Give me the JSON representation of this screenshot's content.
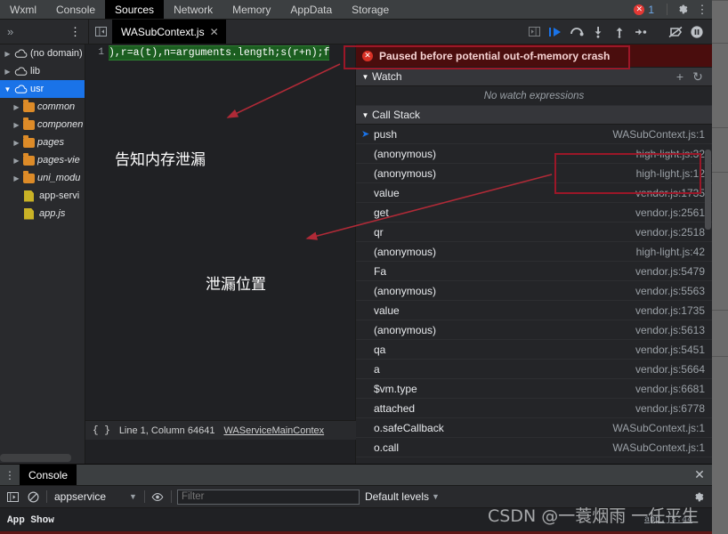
{
  "window": {
    "tabs": [
      {
        "label": "Wxml",
        "active": false
      },
      {
        "label": "Console",
        "active": false
      },
      {
        "label": "Sources",
        "active": true
      },
      {
        "label": "Network",
        "active": false
      },
      {
        "label": "Memory",
        "active": false
      },
      {
        "label": "AppData",
        "active": false
      },
      {
        "label": "Storage",
        "active": false
      }
    ],
    "error_count": "1",
    "error_icon": "error-circle-icon",
    "settings_icon": "gear-icon",
    "more_icon": "kebab-menu-icon"
  },
  "toolbar": {
    "more_tabs_icon": "chevron-double-right-icon",
    "panel_menu_icon": "kebab-menu-icon",
    "show_navigator_icon": "show-navigator-icon",
    "show_debugger_icon": "show-debugger-icon",
    "file_tab": {
      "label": "WASubContext.js",
      "close_icon": "close-icon"
    },
    "debug_buttons": [
      {
        "name": "resume-button",
        "glyph": "resume-icon"
      },
      {
        "name": "step-over-button",
        "glyph": "step-over-icon"
      },
      {
        "name": "step-into-button",
        "glyph": "step-into-icon"
      },
      {
        "name": "step-out-button",
        "glyph": "step-out-icon"
      },
      {
        "name": "step-button",
        "glyph": "step-icon"
      },
      {
        "name": "deactivate-breakpoints-button",
        "glyph": "deactivate-breakpoints-icon"
      },
      {
        "name": "pause-on-exceptions-button",
        "glyph": "pause-icon"
      }
    ]
  },
  "navigator": {
    "items": [
      {
        "label": "(no domain)",
        "icon": "cloud-icon",
        "expanded": false,
        "indent": 0,
        "selected": false,
        "type": "domain"
      },
      {
        "label": "lib",
        "icon": "cloud-icon",
        "expanded": false,
        "indent": 0,
        "selected": false,
        "type": "domain"
      },
      {
        "label": "usr",
        "icon": "cloud-icon",
        "expanded": true,
        "indent": 0,
        "selected": true,
        "type": "domain"
      },
      {
        "label": "common",
        "icon": "folder-icon",
        "expanded": false,
        "indent": 1,
        "selected": false,
        "type": "folder"
      },
      {
        "label": "componen",
        "icon": "folder-icon",
        "expanded": false,
        "indent": 1,
        "selected": false,
        "type": "folder"
      },
      {
        "label": "pages",
        "icon": "folder-icon",
        "expanded": false,
        "indent": 1,
        "selected": false,
        "type": "folder"
      },
      {
        "label": "pages-vie",
        "icon": "folder-icon",
        "expanded": false,
        "indent": 1,
        "selected": false,
        "type": "folder"
      },
      {
        "label": "uni_modu",
        "icon": "folder-icon",
        "expanded": false,
        "indent": 1,
        "selected": false,
        "type": "folder"
      },
      {
        "label": "app-servi",
        "icon": "file-icon",
        "expanded": null,
        "indent": 1,
        "selected": false,
        "type": "file"
      },
      {
        "label": "app.js",
        "icon": "file-icon",
        "expanded": null,
        "indent": 1,
        "selected": false,
        "type": "file"
      }
    ]
  },
  "editor": {
    "line_number": "1",
    "code": "),r=a(t),n=arguments.length;s(r+n);f",
    "annotations": [
      {
        "text": "告知内存泄漏",
        "name": "annotation-memory-leak-notice"
      },
      {
        "text": "泄漏位置",
        "name": "annotation-leak-location"
      }
    ]
  },
  "status_bar": {
    "braces_icon": "format-braces-icon",
    "position": "Line 1, Column 64641",
    "context_link": "WAServiceMainContex"
  },
  "debugger": {
    "paused_banner": {
      "text": "Paused before potential out-of-memory crash",
      "icon": "error-circle-icon"
    },
    "watch": {
      "title": "Watch",
      "empty_text": "No watch expressions",
      "add_icon": "plus-icon",
      "refresh_icon": "refresh-icon"
    },
    "call_stack": {
      "title": "Call Stack",
      "frames": [
        {
          "fn": "push",
          "loc": "WASubContext.js:1",
          "current": true
        },
        {
          "fn": "(anonymous)",
          "loc": "high-light.js:32",
          "current": false
        },
        {
          "fn": "(anonymous)",
          "loc": "high-light.js:12",
          "current": false
        },
        {
          "fn": "value",
          "loc": "vendor.js:1735",
          "current": false
        },
        {
          "fn": "get",
          "loc": "vendor.js:2561",
          "current": false
        },
        {
          "fn": "qr",
          "loc": "vendor.js:2518",
          "current": false
        },
        {
          "fn": "(anonymous)",
          "loc": "high-light.js:42",
          "current": false
        },
        {
          "fn": "Fa",
          "loc": "vendor.js:5479",
          "current": false
        },
        {
          "fn": "(anonymous)",
          "loc": "vendor.js:5563",
          "current": false
        },
        {
          "fn": "value",
          "loc": "vendor.js:1735",
          "current": false
        },
        {
          "fn": "(anonymous)",
          "loc": "vendor.js:5613",
          "current": false
        },
        {
          "fn": "qa",
          "loc": "vendor.js:5451",
          "current": false
        },
        {
          "fn": "a",
          "loc": "vendor.js:5664",
          "current": false
        },
        {
          "fn": "$vm.type",
          "loc": "vendor.js:6681",
          "current": false
        },
        {
          "fn": "attached",
          "loc": "vendor.js:6778",
          "current": false
        },
        {
          "fn": "o.safeCallback",
          "loc": "WASubContext.js:1",
          "current": false
        },
        {
          "fn": "o.call",
          "loc": "WASubContext.js:1",
          "current": false
        }
      ]
    }
  },
  "drawer": {
    "menu_icon": "kebab-menu-icon",
    "tab_label": "Console",
    "close_icon": "close-icon",
    "sidebar_toggle_icon": "console-sidebar-icon",
    "clear_icon": "clear-console-icon",
    "context": "appservice",
    "context_caret": "chevron-down-icon",
    "eye_icon": "eye-icon",
    "filter_placeholder": "Filter",
    "filter_value": "",
    "levels_label": "Default levels",
    "levels_caret": "chevron-down-icon",
    "settings_icon": "gear-icon",
    "log": {
      "text": "App  Show",
      "source": "app.js:44"
    }
  },
  "watermark": {
    "text": "CSDN @一蓑烟雨  一任平生"
  },
  "colors": {
    "accent_blue": "#1a73e8",
    "annotation_red": "#9c1728",
    "paused_bg": "#4a0d0d",
    "selection_green": "#1b5e20",
    "folder_orange": "#dd8b28",
    "file_yellow": "#c9b226"
  }
}
